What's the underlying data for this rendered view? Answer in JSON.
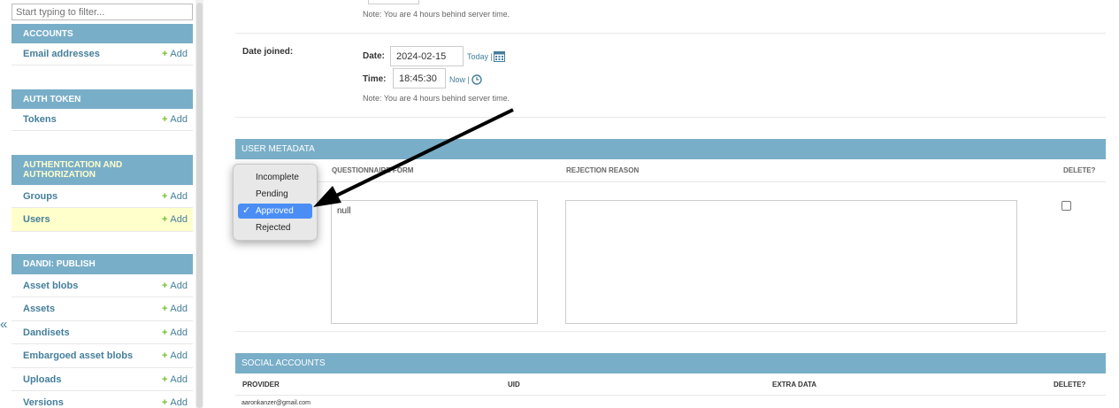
{
  "sidebar": {
    "filter_placeholder": "Start typing to filter...",
    "collapse_label": "«",
    "add_label": "Add",
    "modules": [
      {
        "title": "Accounts",
        "items": [
          {
            "label": "Email addresses"
          }
        ]
      },
      {
        "title": "Auth Token",
        "items": [
          {
            "label": "Tokens"
          }
        ]
      },
      {
        "title": "Authentication and Authorization",
        "items": [
          {
            "label": "Groups"
          },
          {
            "label": "Users"
          }
        ]
      },
      {
        "title": "Dandi: Publish",
        "items": [
          {
            "label": "Asset blobs"
          },
          {
            "label": "Assets"
          },
          {
            "label": "Dandisets"
          },
          {
            "label": "Embargoed asset blobs"
          },
          {
            "label": "Uploads"
          },
          {
            "label": "Versions"
          }
        ]
      }
    ]
  },
  "form": {
    "note": "Note: You are 4 hours behind server time.",
    "date_joined_label": "Date joined:",
    "date_label": "Date:",
    "date_value": "2024-02-15",
    "today_link": "Today",
    "time_label": "Time:",
    "time_value": "18:45:30",
    "now_link": "Now",
    "link_sep": "|"
  },
  "user_metadata": {
    "title": "USER METADATA",
    "col_questionnaire": "QUESTIONNAIRE FORM",
    "col_rejection": "REJECTION REASON",
    "col_delete": "DELETE?",
    "questionnaire_value": "null",
    "status_options": [
      "Incomplete",
      "Pending",
      "Approved",
      "Rejected"
    ],
    "status_selected": "Approved"
  },
  "social_accounts": {
    "title": "SOCIAL ACCOUNTS",
    "col_provider": "PROVIDER",
    "col_uid": "UID",
    "col_extra": "EXTRA DATA",
    "col_delete": "DELETE?",
    "row_email": "aaronkanzer@gmail.com"
  },
  "colors": {
    "module_header": "#79aec8",
    "link": "#447e9b",
    "add_plus": "#70bf2b",
    "selected_row": "#ffffcc",
    "dropdown_selected": "#4a8ef5"
  }
}
